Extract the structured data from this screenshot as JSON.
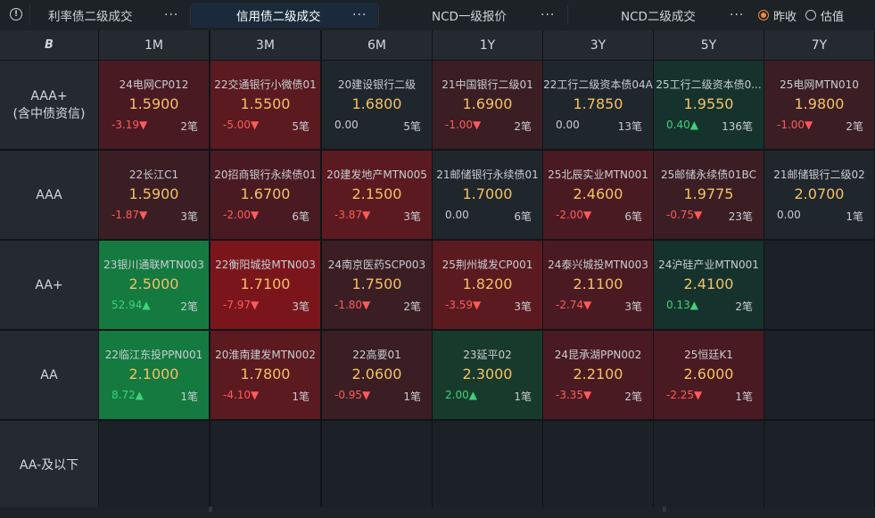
{
  "tabs": [
    {
      "label": "利率债二级成交",
      "dots": "···"
    },
    {
      "label": "信用债二级成交",
      "dots": "···"
    },
    {
      "label": "NCD一级报价",
      "dots": "···"
    },
    {
      "label": "NCD二级成交",
      "dots": "···"
    }
  ],
  "radios": [
    {
      "label": "昨收",
      "checked": true
    },
    {
      "label": "估值",
      "checked": false
    }
  ],
  "colors": {
    "accent": "#f08a3c",
    "rate": "#f4c163",
    "up": "#3fd27a",
    "down": "#ff5a5a"
  },
  "grid": {
    "corner_icon": "B",
    "columns": [
      "1M",
      "3M",
      "6M",
      "1Y",
      "3Y",
      "5Y",
      "7Y"
    ],
    "rows": [
      {
        "label": "AAA+",
        "sublabel": "(含中债资信)",
        "cells": [
          {
            "name": "24电网CP012",
            "rate": "1.5900",
            "chg": "-3.19▼",
            "cnt": "2笔",
            "dir": "down",
            "bg": "bg-dred2"
          },
          {
            "name": "22交通银行小微债01",
            "rate": "1.5500",
            "chg": "-5.00▼",
            "cnt": "5笔",
            "dir": "down",
            "bg": "bg-red1"
          },
          {
            "name": "20建设银行二级",
            "rate": "1.6800",
            "chg": "0.00",
            "cnt": "5笔",
            "dir": "flat",
            "bg": "bg-neutral"
          },
          {
            "name": "21中国银行二级01",
            "rate": "1.6900",
            "chg": "-1.00▼",
            "cnt": "2笔",
            "dir": "down",
            "bg": "bg-dred1"
          },
          {
            "name": "22工行二级资本债04A",
            "rate": "1.7850",
            "chg": "0.00",
            "cnt": "13笔",
            "dir": "flat",
            "bg": "bg-neutral"
          },
          {
            "name": "25工行二级资本债0...",
            "rate": "1.9550",
            "chg": "0.40▲",
            "cnt": "136笔",
            "dir": "up",
            "bg": "bg-dgreen1"
          },
          {
            "name": "25电网MTN010",
            "rate": "1.9800",
            "chg": "-1.00▼",
            "cnt": "2笔",
            "dir": "down",
            "bg": "bg-dred1"
          }
        ]
      },
      {
        "label": "AAA",
        "sublabel": "",
        "cells": [
          {
            "name": "22长江C1",
            "rate": "1.5900",
            "chg": "-1.87▼",
            "cnt": "3笔",
            "dir": "down",
            "bg": "bg-dred1"
          },
          {
            "name": "20招商银行永续债01",
            "rate": "1.6700",
            "chg": "-2.00▼",
            "cnt": "6笔",
            "dir": "down",
            "bg": "bg-dred2"
          },
          {
            "name": "20建发地产MTN005",
            "rate": "2.1500",
            "chg": "-3.87▼",
            "cnt": "3笔",
            "dir": "down",
            "bg": "bg-red1"
          },
          {
            "name": "21邮储银行永续债01",
            "rate": "1.7000",
            "chg": "0.00",
            "cnt": "6笔",
            "dir": "flat",
            "bg": "bg-neutral"
          },
          {
            "name": "25北辰实业MTN001",
            "rate": "2.4600",
            "chg": "-2.00▼",
            "cnt": "6笔",
            "dir": "down",
            "bg": "bg-dred2"
          },
          {
            "name": "25邮储永续债01BC",
            "rate": "1.9775",
            "chg": "-0.75▼",
            "cnt": "23笔",
            "dir": "down",
            "bg": "bg-dred1"
          },
          {
            "name": "21邮储银行二级02",
            "rate": "2.0700",
            "chg": "0.00",
            "cnt": "1笔",
            "dir": "flat",
            "bg": "bg-neutral"
          }
        ]
      },
      {
        "label": "AA+",
        "sublabel": "",
        "cells": [
          {
            "name": "23银川通联MTN003",
            "rate": "2.5000",
            "chg": "52.94▲",
            "cnt": "2笔",
            "dir": "up",
            "bg": "bg-green"
          },
          {
            "name": "22衡阳城投MTN003",
            "rate": "1.7100",
            "chg": "-7.97▼",
            "cnt": "3笔",
            "dir": "down",
            "bg": "bg-red3"
          },
          {
            "name": "24南京医药SCP003",
            "rate": "1.7500",
            "chg": "-1.80▼",
            "cnt": "2笔",
            "dir": "down",
            "bg": "bg-dred1"
          },
          {
            "name": "25荆州城发CP001",
            "rate": "1.8200",
            "chg": "-3.59▼",
            "cnt": "3笔",
            "dir": "down",
            "bg": "bg-red1"
          },
          {
            "name": "24泰兴城投MTN003",
            "rate": "2.1100",
            "chg": "-2.74▼",
            "cnt": "3笔",
            "dir": "down",
            "bg": "bg-dred2"
          },
          {
            "name": "24沪硅产业MTN001",
            "rate": "2.4100",
            "chg": "0.13▲",
            "cnt": "2笔",
            "dir": "up",
            "bg": "bg-dgreen1"
          },
          null
        ]
      },
      {
        "label": "AA",
        "sublabel": "",
        "cells": [
          {
            "name": "22临江东投PPN001",
            "rate": "2.1000",
            "chg": "8.72▲",
            "cnt": "1笔",
            "dir": "up",
            "bg": "bg-green"
          },
          {
            "name": "20淮南建发MTN002",
            "rate": "1.7800",
            "chg": "-4.10▼",
            "cnt": "1笔",
            "dir": "down",
            "bg": "bg-red1"
          },
          {
            "name": "22高要01",
            "rate": "2.0600",
            "chg": "-0.95▼",
            "cnt": "1笔",
            "dir": "down",
            "bg": "bg-dred1"
          },
          {
            "name": "23延平02",
            "rate": "2.3000",
            "chg": "2.00▲",
            "cnt": "1笔",
            "dir": "up",
            "bg": "bg-dgreen2"
          },
          {
            "name": "24昆承湖PPN002",
            "rate": "2.2100",
            "chg": "-3.35▼",
            "cnt": "2笔",
            "dir": "down",
            "bg": "bg-dred2"
          },
          {
            "name": "25恒廷K1",
            "rate": "2.6000",
            "chg": "-2.25▼",
            "cnt": "1笔",
            "dir": "down",
            "bg": "bg-dred2"
          },
          null
        ]
      },
      {
        "label": "AA-及以下",
        "sublabel": "",
        "cells": [
          null,
          null,
          null,
          null,
          null,
          null,
          null
        ]
      }
    ]
  }
}
